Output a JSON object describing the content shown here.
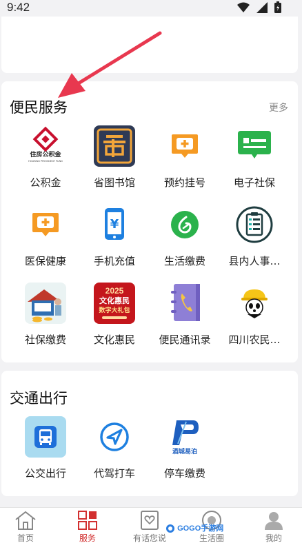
{
  "status_bar": {
    "time": "9:42"
  },
  "services": {
    "title": "便民服务",
    "more": "更多",
    "items": [
      {
        "label": "公积金",
        "icon": "housing-fund-icon",
        "logo_text": "住房公积金",
        "logo_sub": "HOUSING PROVIDENT FUND"
      },
      {
        "label": "省图书馆",
        "icon": "library-icon"
      },
      {
        "label": "预约挂号",
        "icon": "appointment-icon"
      },
      {
        "label": "电子社保",
        "icon": "e-social-security-icon"
      },
      {
        "label": "医保健康",
        "icon": "medical-insurance-icon"
      },
      {
        "label": "手机充值",
        "icon": "phone-recharge-icon"
      },
      {
        "label": "生活缴费",
        "icon": "utility-payment-icon"
      },
      {
        "label": "县内人事…",
        "icon": "personnel-icon"
      },
      {
        "label": "社保缴费",
        "icon": "social-security-payment-icon"
      },
      {
        "label": "文化惠民",
        "icon": "culture-benefit-icon",
        "poster_year": "2025",
        "poster_line1": "文化惠民",
        "poster_line2": "数字大礼包"
      },
      {
        "label": "便民通讯录",
        "icon": "phonebook-icon"
      },
      {
        "label": "四川农民…",
        "icon": "farmer-icon"
      }
    ]
  },
  "transit": {
    "title": "交通出行",
    "items": [
      {
        "label": "公交出行",
        "icon": "bus-icon"
      },
      {
        "label": "代驾打车",
        "icon": "taxi-icon"
      },
      {
        "label": "停车缴费",
        "icon": "parking-icon",
        "logo_text": "酒城易泊"
      }
    ]
  },
  "bottom_nav": {
    "items": [
      {
        "label": "首页",
        "icon": "home-icon",
        "active": false
      },
      {
        "label": "服务",
        "icon": "services-icon",
        "active": true
      },
      {
        "label": "有话您说",
        "icon": "feedback-icon",
        "active": false
      },
      {
        "label": "生活圈",
        "icon": "life-circle-icon",
        "active": false
      },
      {
        "label": "我的",
        "icon": "profile-icon",
        "active": false
      }
    ]
  },
  "watermark": "GOGO手游网",
  "colors": {
    "accent": "#d23030",
    "arrow": "#e8384f",
    "orange": "#f59a23",
    "green": "#2bb24c",
    "blue": "#1e80e0"
  }
}
